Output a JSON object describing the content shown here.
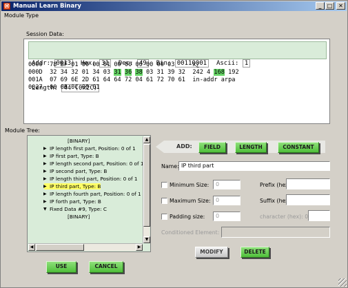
{
  "window": {
    "title": "Manual Learn Binary",
    "icon_glyph": "Ⓜ",
    "minimize_glyph": "_",
    "maximize_glyph": "□",
    "close_glyph": "✕"
  },
  "menu": {
    "module_type": "Module Type"
  },
  "session": {
    "label": "Session Data:",
    "addr_label": "Addr:",
    "addr": "0013",
    "hex_label": "Hex:",
    "hex": "31",
    "dec_label": "Dec:",
    "dec": "49",
    "bin_label": "Bin:",
    "bin": "00110001",
    "ascii_label": "Ascii:",
    "ascii": "1",
    "length_label": "Length:",
    "length": "44 (0x2C)",
    "rows": [
      {
        "offset": "0000",
        "bytes": [
          "78",
          "BF",
          "01",
          "00",
          "00",
          "01",
          "00",
          "00",
          "00",
          "00",
          "00",
          "03"
        ],
        "ascii": "x¿"
      },
      {
        "offset": "000D",
        "bytes": [
          "32",
          "34",
          "32",
          "01",
          "34",
          "03",
          "31",
          "36",
          "38",
          "03",
          "31",
          "39",
          "32"
        ],
        "ascii": "242 4 168 192",
        "highlight": [
          6,
          7,
          8
        ]
      },
      {
        "offset": "001A",
        "bytes": [
          "07",
          "69",
          "6E",
          "2D",
          "61",
          "64",
          "64",
          "72",
          "04",
          "61",
          "72",
          "70",
          "61"
        ],
        "ascii": "in-addr arpa"
      },
      {
        "offset": "0027",
        "bytes": [
          "00",
          "00",
          "0C",
          "00",
          "01"
        ],
        "ascii": ""
      }
    ]
  },
  "tree": {
    "label": "Module Tree:",
    "items": [
      {
        "text": "[BINARY]",
        "arrow": "",
        "plain": true
      },
      {
        "text": "IP length first part, Position: 0 of 1",
        "arrow": "▶"
      },
      {
        "text": "IP first part, Type: B",
        "arrow": "▶"
      },
      {
        "text": "IP length second part, Position: 0 of 1",
        "arrow": "▶"
      },
      {
        "text": "IP second part, Type: B",
        "arrow": "▶"
      },
      {
        "text": "IP length third part, Position: 0 of 1",
        "arrow": "▶"
      },
      {
        "text": "IP third part, Type: B",
        "arrow": "▶",
        "selected": true
      },
      {
        "text": "IP length fourth part, Position: 0 of 1",
        "arrow": "▶"
      },
      {
        "text": "IP forth part, Type: B",
        "arrow": "▶"
      },
      {
        "text": "Fixed Data #9, Type: C",
        "arrow": "▼"
      },
      {
        "text": "[BINARY]",
        "arrow": "",
        "plain": true
      }
    ]
  },
  "editor": {
    "add_label": "ADD:",
    "field_button": "FIELD",
    "length_button": "LENGTH",
    "constant_button": "CONSTANT",
    "name_label": "Name:",
    "name_value": "IP third part",
    "min_size_label": "Minimum Size:",
    "min_size_value": "0",
    "max_size_label": "Maximum Size:",
    "max_size_value": "0",
    "padding_size_label": "Padding size:",
    "padding_size_value": "0",
    "prefix_label": "Prefix (hex):",
    "prefix_value": "",
    "suffix_label": "Suffix (hex):",
    "suffix_value": "",
    "character_label": "character (hex): 0x",
    "character_value": "",
    "conditioned_label": "Conditioned Element:",
    "conditioned_value": "",
    "modify_button": "MODIFY",
    "delete_button": "DELETE"
  },
  "footer": {
    "use_button": "USE",
    "cancel_button": "CANCEL"
  },
  "colors": {
    "accent_green": "#4fbf3a",
    "highlight_green": "#66d466",
    "selection_yellow": "#ffff66",
    "tree_bg": "#d9ecd9"
  }
}
